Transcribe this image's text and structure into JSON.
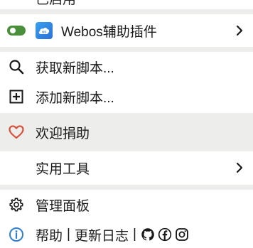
{
  "menu": {
    "top_cut_label": "已启用",
    "script": {
      "name": "Webos辅助插件",
      "enabled": true,
      "icon": "webos-cloud-icon"
    },
    "get_new": "获取新脚本...",
    "add_new": "添加新脚本...",
    "donate": "欢迎捐助",
    "tools": "实用工具",
    "dashboard": "管理面板",
    "footer": {
      "help": "帮助",
      "separator": "|",
      "changelog": "更新日志",
      "icons": [
        "github-icon",
        "facebook-icon",
        "instagram-icon"
      ]
    }
  },
  "colors": {
    "toggle_on": "#4a8f3a",
    "heart": "#d9503a",
    "info": "#2f7fd0",
    "separator": "#ededeb",
    "hover_bg": "#ededeb"
  }
}
